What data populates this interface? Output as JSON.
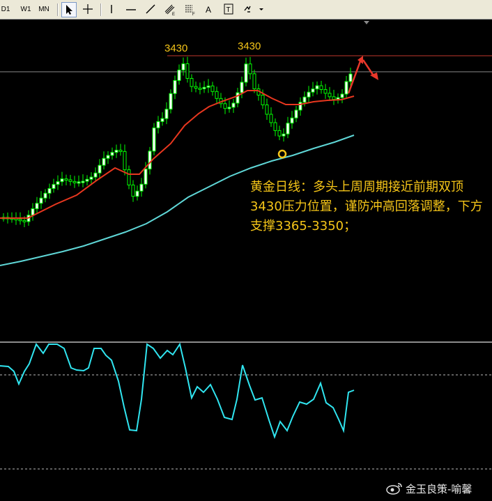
{
  "toolbar": {
    "timeframes": [
      "D1",
      "W1",
      "MN"
    ],
    "tools": [
      {
        "icon": "cursor-arrow-icon",
        "active": true
      },
      {
        "icon": "crosshair-icon"
      },
      {
        "icon": "vertical-line-icon"
      },
      {
        "icon": "horizontal-line-icon"
      },
      {
        "icon": "trendline-icon"
      },
      {
        "icon": "equidistant-channel-icon"
      },
      {
        "icon": "fibonacci-retracement-icon"
      },
      {
        "icon": "text-icon",
        "label": "A"
      },
      {
        "icon": "text-label-icon",
        "label": "T"
      },
      {
        "icon": "arrows-dropdown-icon"
      }
    ]
  },
  "chart": {
    "peak_labels": [
      "3430",
      "3430"
    ],
    "annotation": "黄金日线：多头上周周期接近前期双顶3430压力位置，谨防冲高回落调整，下方支撑3365-3350；",
    "colors": {
      "background": "#000000",
      "candle_bull": "#ffffff",
      "candle_bear": "#000000",
      "candle_wick": "#00ff00",
      "ma_short": "#e8371f",
      "ma_long": "#5fd7d7",
      "oscillator": "#30e5f0",
      "resistance_line": "#c0392b",
      "price_line": "#8a8a8a",
      "annotation_text": "#f5c518",
      "arrow": "#e8372a"
    }
  },
  "watermark": "金玉良策-喻馨"
}
